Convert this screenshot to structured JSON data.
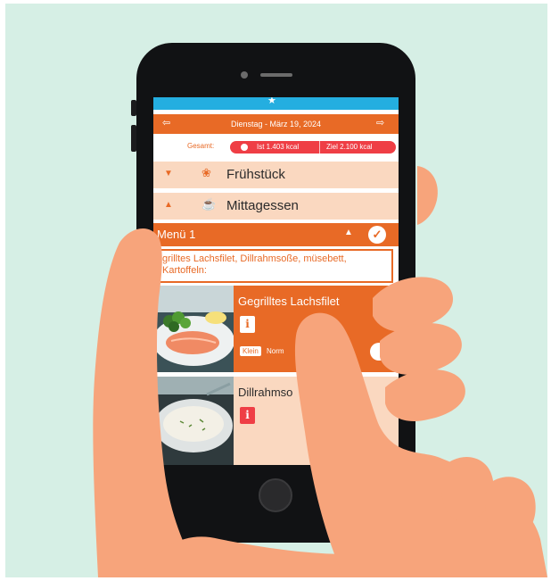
{
  "app": {
    "top_icon": "home-icon",
    "date_nav": {
      "prev_icon": "arrow-left-icon",
      "next_icon": "arrow-right-icon",
      "date": "Dienstag - März 19, 2024"
    },
    "totals": {
      "label": "Gesamt:",
      "ist": "Ist 1.403 kcal",
      "ziel": "Ziel 2.100 kcal"
    },
    "meals": [
      {
        "label": "Frühstück",
        "icon": "croissant-icon",
        "state": "collapsed"
      },
      {
        "label": "Mittagessen",
        "icon": "bowl-icon",
        "state": "expanded"
      }
    ],
    "menu": {
      "title": "Menü 1",
      "description": "grilltes Lachsfilet, Dillrahmsoße, müsebett, Kartoffeln:",
      "dishes": [
        {
          "name": "Gegrilltes Lachsfilet",
          "info": "i",
          "size_small": "Klein",
          "size_normal": "Norm",
          "selected": true
        },
        {
          "name": "Dillrahmso",
          "info": "i",
          "selected": false
        }
      ]
    }
  },
  "colors": {
    "accent": "#e86a26",
    "light_accent": "#fad8c0",
    "alert": "#ef3e45",
    "header_blue": "#24aee0",
    "background": "#d6efe5",
    "skin": "#f7a47b"
  }
}
